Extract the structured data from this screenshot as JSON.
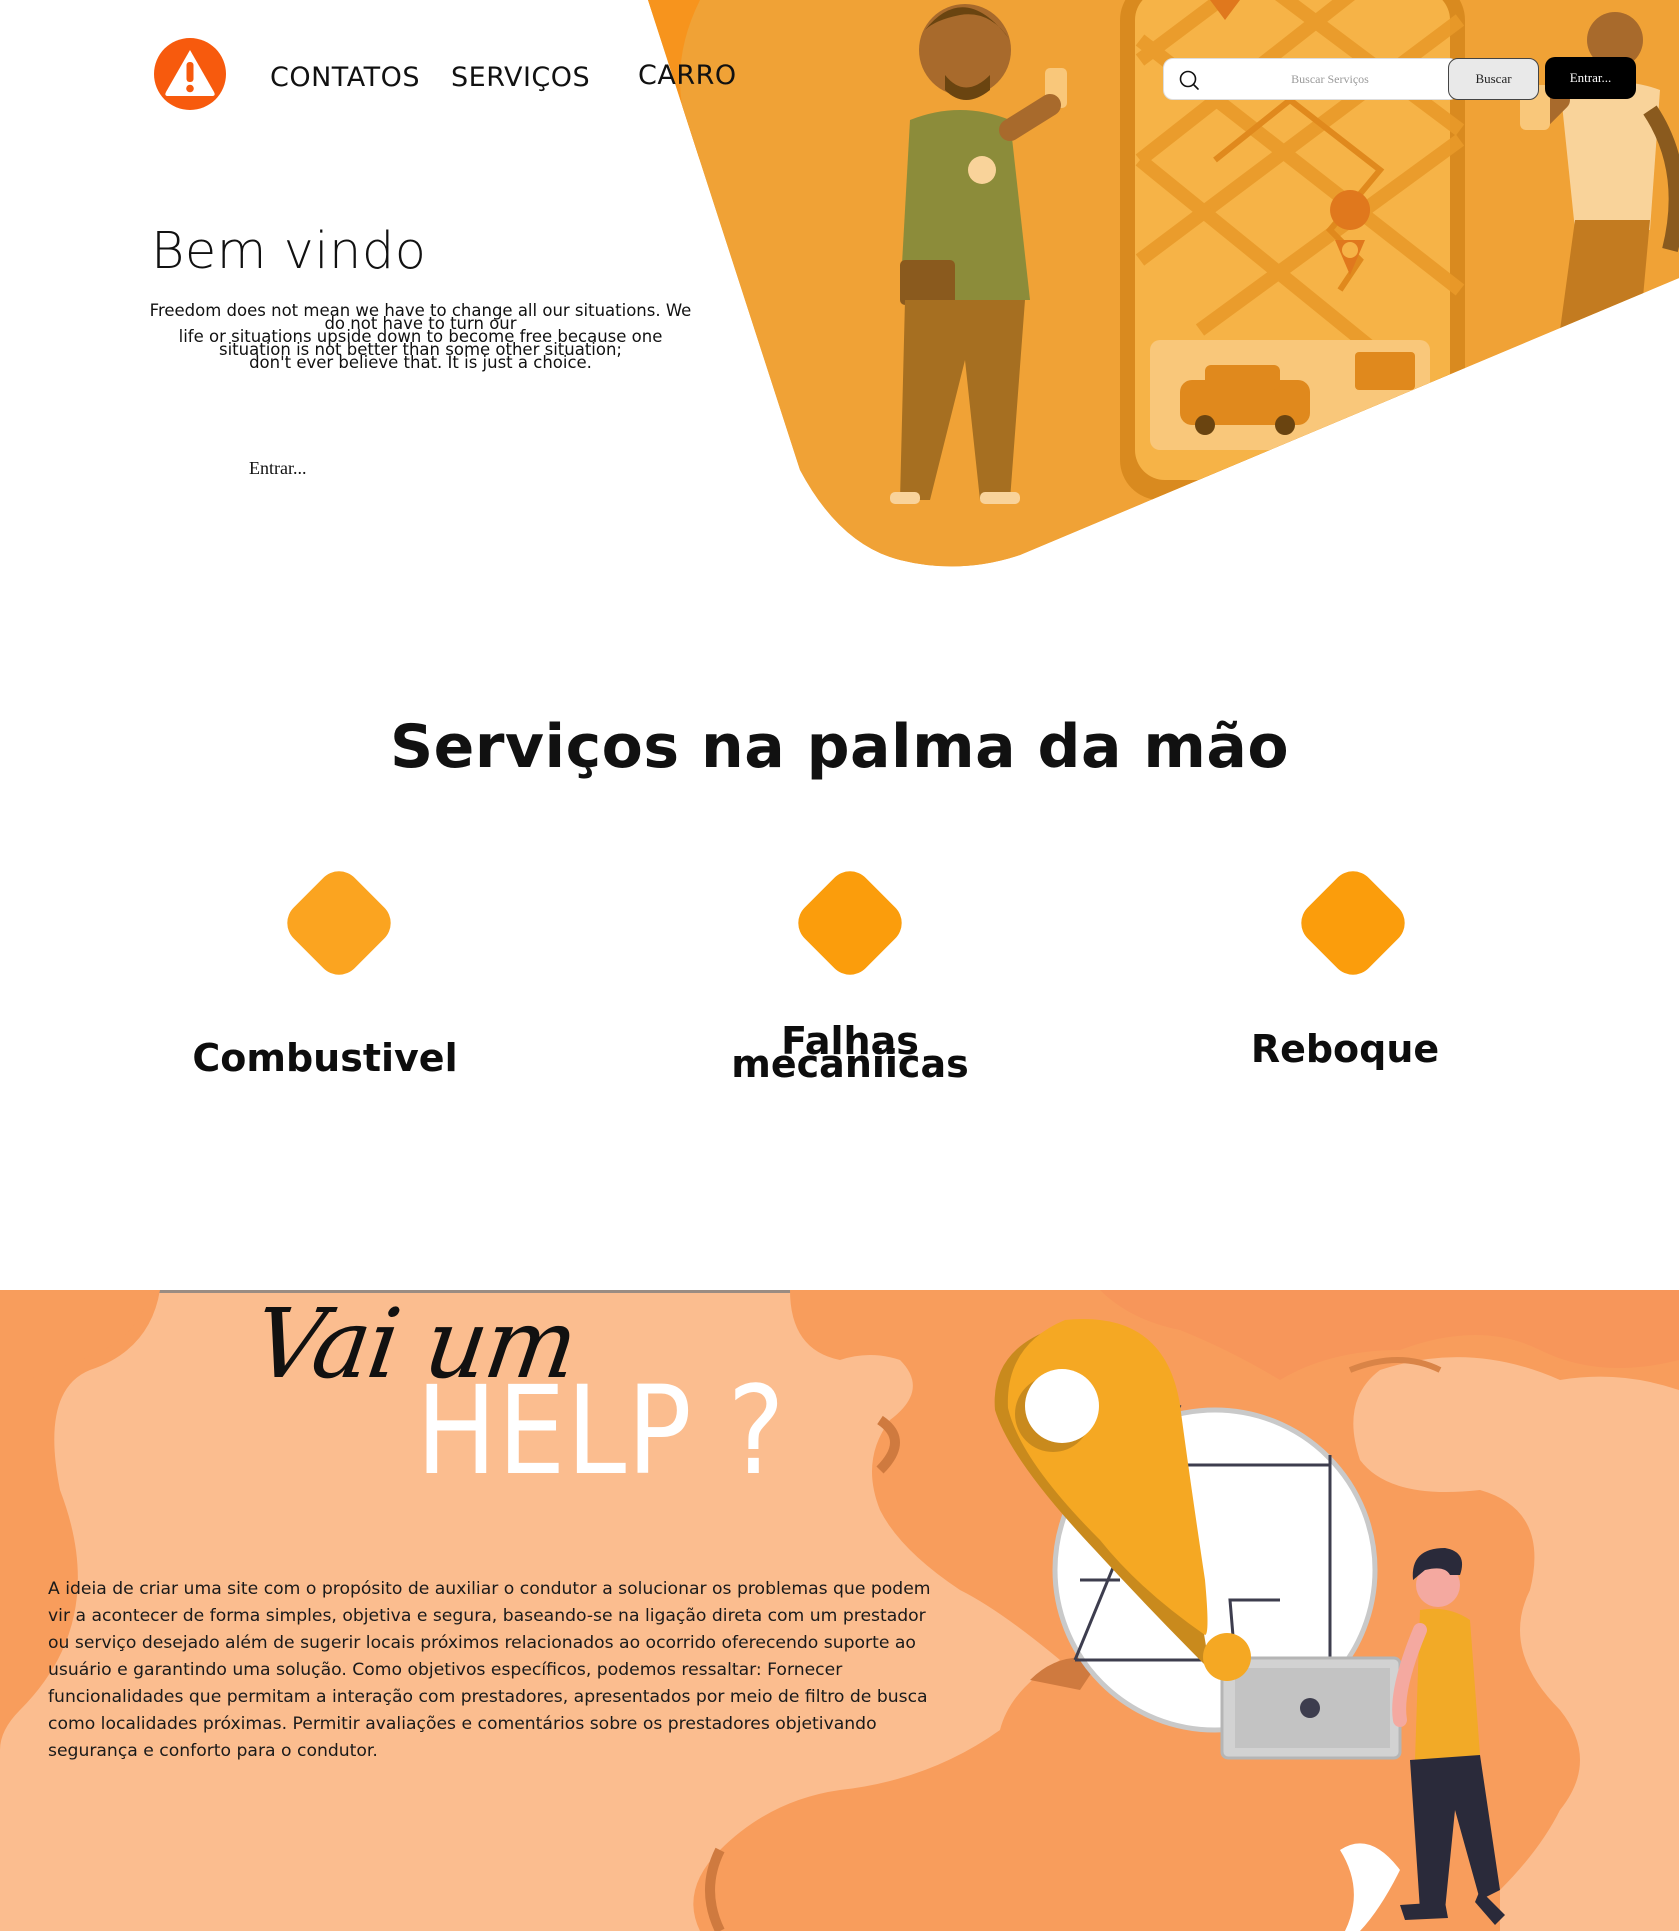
{
  "nav": {
    "links": [
      "CONTATOS",
      "SERVIÇOS",
      "CARRO"
    ],
    "search_placeholder": "Buscar Serviços",
    "search_button": "Buscar",
    "login_button": "Entrar..."
  },
  "hero": {
    "title": "Bem vindo",
    "text_lines": [
      "Freedom does not mean we have to change all our situations. We",
      "do not have to turn our",
      "life or situations upside down to become free because one",
      "situation is not better than some other situation;",
      "don't ever believe that. It is just a choice."
    ],
    "cta": "Entrar..."
  },
  "services": {
    "title": "Serviços na palma da mão",
    "items": [
      {
        "label": "Combustivel"
      },
      {
        "label_lines": [
          "Falhas",
          "mecaniicas"
        ]
      },
      {
        "label": "Reboque"
      }
    ]
  },
  "help": {
    "script": "Vai um",
    "big": "HELP ?",
    "description": "A ideia de criar uma site com o propósito de auxiliar o condutor a solucionar os problemas que podem vir a acontecer de forma simples, objetiva e segura, baseando-se na ligação direta com um prestador ou serviço desejado além de sugerir locais próximos relacionados ao ocorrido oferecendo suporte ao usuário e garantindo uma solução. Como objetivos específicos, podemos ressaltar: Fornecer funcionalidades que permitam a interação com prestadores, apresentados por meio de filtro de busca como localidades próximas. Permitir avaliações e comentários sobre os prestadores objetivando segurança e conforto para o condutor."
  },
  "colors": {
    "accent": "#f7a01c",
    "logo": "#f75a0d",
    "help_bg": "#fbbd8f",
    "help_blob": "#f89d5c"
  },
  "icons": [
    "warning-logo-icon",
    "search-icon",
    "service-diamond-icon",
    "map-pin-icon"
  ]
}
